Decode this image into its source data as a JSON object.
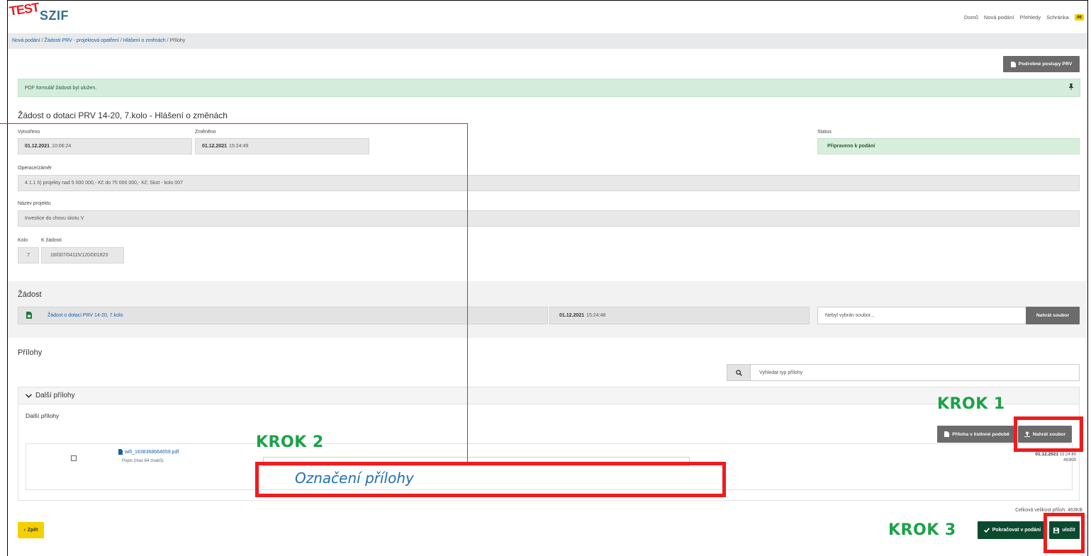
{
  "header": {
    "logo_test": "TEST",
    "logo_brand": "SZIF",
    "nav": [
      "Domů",
      "Nová podání",
      "Přehledy",
      "Schránka"
    ],
    "inbox_count": "46"
  },
  "breadcrumb": {
    "items": [
      "Nová podání",
      "Žádosti PRV - projektová opatření",
      "Hlášení o změnách"
    ],
    "current": "Přílohy"
  },
  "toolbar": {
    "procedures_label": "Podrobné postupy PRV"
  },
  "alert": {
    "message": "PDF formulář žádosti byl uložen."
  },
  "form": {
    "title": "Žádost o dotaci PRV 14-20, 7.kolo - Hlášení o změnách",
    "created_label": "Vytvořeno",
    "created_date": "01.12.2021",
    "created_time": "10:06:24",
    "changed_label": "Změněno",
    "changed_date": "01.12.2021",
    "changed_time": "15:24:49",
    "status_label": "Status",
    "status_value": "Připraveno k podání",
    "operation_label": "Operace/záměr",
    "operation_value": "4.1.1 h) projekty nad 5 000 000,- Kč do 75 000 000,- Kč; Skot - kolo 007",
    "project_label": "Název projektu",
    "project_value": "Investice do chovu skotu V",
    "round_label": "Kolo",
    "round_value": "7",
    "request_label": "K žádosti",
    "request_value": "18/007/0411h/120/001823"
  },
  "zadost": {
    "section_title": "Žádost",
    "doc_link": "Žádost o dotaci PRV 14-20, 7.kolo",
    "date": "01.12.2021",
    "time": "15:24:48",
    "file_placeholder": "Nebyl vybrán soubor...",
    "upload_label": "Nahrát soubor"
  },
  "prilohy": {
    "section_title": "Přílohy",
    "search_placeholder": "Vyhledat typ přílohy",
    "panel_title": "Další přílohy",
    "panel_subtitle": "Další přílohy",
    "paper_button": "Příloha v listinné podobě",
    "upload_button": "Nahrát soubor",
    "file_name": "wifi_1638368664659.pdf",
    "description_label": "Popis (max 64 znaků):",
    "file_date": "01.12.2021",
    "file_time": "15:24:49",
    "file_size": "463KB",
    "total_size": "Celková velikost příloh: 463KB"
  },
  "footer": {
    "back_label": "Zpět",
    "continue_label": "Pokračovat v podání",
    "save_label": "uložit"
  },
  "annotations": {
    "step1": "KROK 1",
    "step2": "KROK 2",
    "step3": "KROK 3",
    "description_hint": "Označení přílohy",
    "highlight_color": "#ee1c1c",
    "step_color": "#19a246"
  }
}
